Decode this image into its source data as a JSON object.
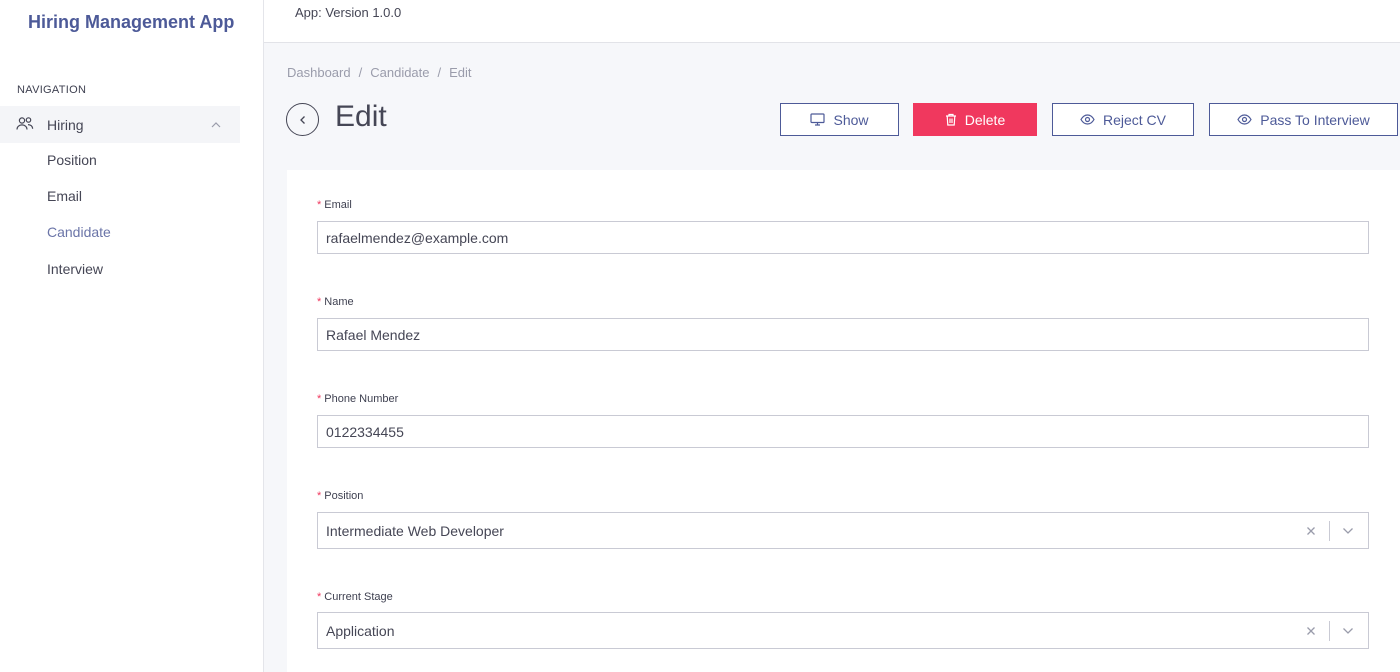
{
  "app": {
    "title": "Hiring Management App",
    "version": "App: Version 1.0.0"
  },
  "sidebar": {
    "heading": "NAVIGATION",
    "group": {
      "label": "Hiring",
      "icon": "users-icon",
      "expanded": true
    },
    "items": [
      {
        "label": "Position",
        "active": false
      },
      {
        "label": "Email",
        "active": false
      },
      {
        "label": "Candidate",
        "active": true
      },
      {
        "label": "Interview",
        "active": false
      }
    ]
  },
  "breadcrumb": [
    "Dashboard",
    "Candidate",
    "Edit"
  ],
  "header": {
    "title": "Edit",
    "buttons": {
      "show": "Show",
      "delete": "Delete",
      "reject": "Reject CV",
      "pass": "Pass To Interview"
    }
  },
  "form": {
    "email": {
      "label": "Email",
      "value": "rafaelmendez@example.com"
    },
    "name": {
      "label": "Name",
      "value": "Rafael Mendez"
    },
    "phone": {
      "label": "Phone Number",
      "value": "0122334455"
    },
    "position": {
      "label": "Position",
      "value": "Intermediate Web Developer"
    },
    "stage": {
      "label": "Current Stage",
      "value": "Application"
    }
  },
  "colors": {
    "accent": "#4d5a98",
    "danger": "#f0385e",
    "text": "#454655"
  }
}
